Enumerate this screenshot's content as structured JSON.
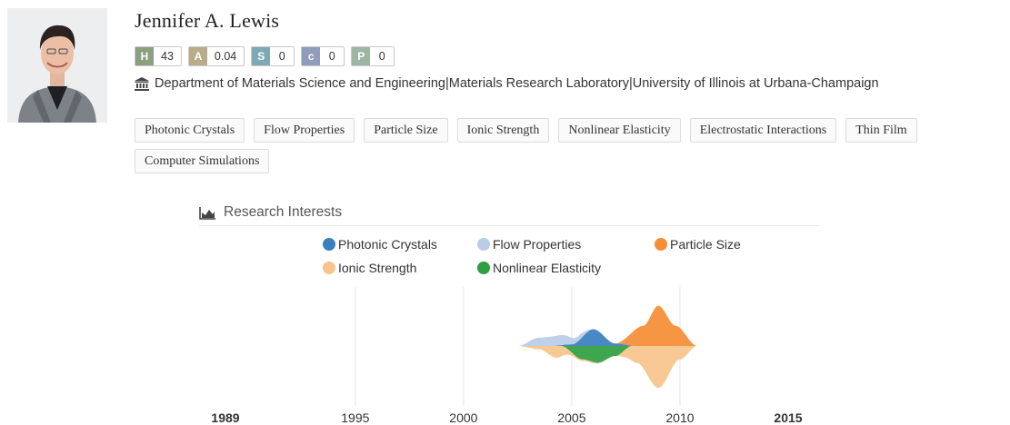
{
  "profile": {
    "name": "Jennifer A. Lewis",
    "affiliation": "Department of Materials Science and Engineering|Materials Research Laboratory|University of Illinois at Urbana-Champaign",
    "metrics": [
      {
        "tag": "H",
        "value": "43",
        "color": "#8aa07e"
      },
      {
        "tag": "A",
        "value": "0.04",
        "color": "#b7ad88"
      },
      {
        "tag": "S",
        "value": "0",
        "color": "#7ea8b3"
      },
      {
        "tag": "c",
        "value": "0",
        "color": "#8f9dbb"
      },
      {
        "tag": "P",
        "value": "0",
        "color": "#9eb5a4"
      }
    ]
  },
  "keywords": [
    "Photonic Crystals",
    "Flow Properties",
    "Particle Size",
    "Ionic Strength",
    "Nonlinear Elasticity",
    "Electrostatic Interactions",
    "Thin Film",
    "Computer Simulations"
  ],
  "research": {
    "title": "Research Interests",
    "icon": "area-chart-icon"
  },
  "chart_data": {
    "type": "area",
    "subtype": "streamgraph",
    "title": "",
    "xlabel": "",
    "ylabel": "",
    "x_ticks": [
      "1989",
      "1995",
      "2000",
      "2005",
      "2010",
      "2015"
    ],
    "bold_ticks": [
      "1989",
      "2015"
    ],
    "xlim": [
      1989,
      2015
    ],
    "gridlines_at": [
      1995,
      2000,
      2005,
      2010
    ],
    "legend_position": "top",
    "series": [
      {
        "name": "Photonic Crystals",
        "color": "#3a7fbe",
        "points": [
          [
            2002.5,
            0
          ],
          [
            2004,
            0
          ],
          [
            2005,
            0.1
          ],
          [
            2006,
            1.0
          ],
          [
            2007,
            0.15
          ],
          [
            2008,
            0
          ],
          [
            2011,
            0
          ]
        ]
      },
      {
        "name": "Flow Properties",
        "color": "#b8cde6",
        "points": [
          [
            2002.5,
            0
          ],
          [
            2003.5,
            0.5
          ],
          [
            2004.5,
            0.6
          ],
          [
            2005.3,
            0.3
          ],
          [
            2006,
            0
          ],
          [
            2011,
            0
          ]
        ]
      },
      {
        "name": "Particle Size",
        "color": "#f58d35",
        "points": [
          [
            2002.5,
            0
          ],
          [
            2007,
            0
          ],
          [
            2008.3,
            1.2
          ],
          [
            2009,
            2.4
          ],
          [
            2009.8,
            1.2
          ],
          [
            2010.8,
            0
          ],
          [
            2011,
            0
          ]
        ]
      },
      {
        "name": "Ionic Strength",
        "color": "#f8c48c",
        "points": [
          [
            2002.5,
            0
          ],
          [
            2003.5,
            0.2
          ],
          [
            2004.3,
            0.7
          ],
          [
            2005.2,
            0.1
          ],
          [
            2007,
            0
          ],
          [
            2008,
            1.0
          ],
          [
            2009,
            2.5
          ],
          [
            2010,
            0.8
          ],
          [
            2010.8,
            0
          ],
          [
            2011,
            0
          ]
        ]
      },
      {
        "name": "Nonlinear Elasticity",
        "color": "#2e9e3f",
        "points": [
          [
            2002.5,
            0
          ],
          [
            2004.5,
            0
          ],
          [
            2005.5,
            0.8
          ],
          [
            2006.2,
            1.0
          ],
          [
            2007,
            0.6
          ],
          [
            2007.8,
            0
          ],
          [
            2011,
            0
          ]
        ]
      }
    ]
  }
}
